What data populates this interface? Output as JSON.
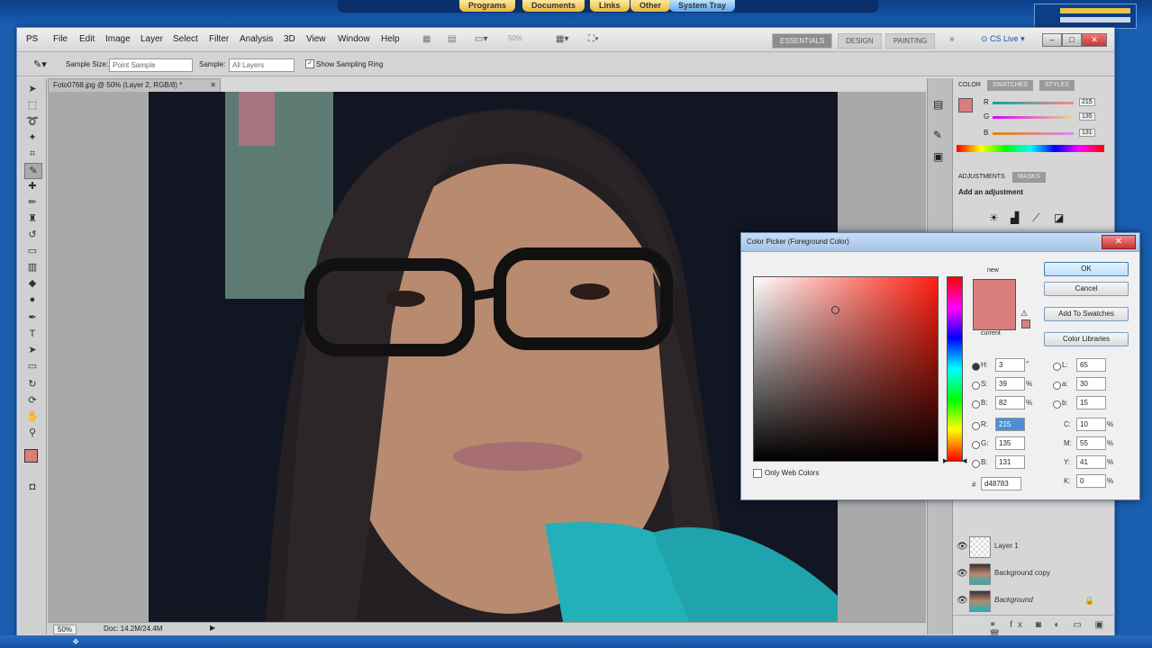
{
  "desktop": {
    "top_tabs": [
      "Programs",
      "Documents",
      "Links",
      "Other",
      "System Tray"
    ]
  },
  "photoshop": {
    "logo": "PS",
    "menu": [
      "File",
      "Edit",
      "Image",
      "Layer",
      "Select",
      "Filter",
      "Analysis",
      "3D",
      "View",
      "Window",
      "Help"
    ],
    "zoom_display": "50%",
    "workspaces": [
      "ESSENTIALS",
      "DESIGN",
      "PAINTING"
    ],
    "cs_live": "CS Live",
    "options_bar": {
      "sample_size_label": "Sample Size:",
      "sample_size_value": "Point Sample",
      "sample_label": "Sample:",
      "sample_value": "All Layers",
      "show_ring_label": "Show Sampling Ring"
    },
    "document_tab": "Foto0768.jpg @ 50% (Layer 2, RGB/8) *",
    "status": {
      "zoom": "50%",
      "doc": "Doc: 14.2M/24.4M"
    }
  },
  "panels": {
    "color_tabs": [
      "COLOR",
      "SWATCHES",
      "STYLES"
    ],
    "color_sliders": [
      {
        "channel": "R",
        "value": "215"
      },
      {
        "channel": "G",
        "value": "135"
      },
      {
        "channel": "B",
        "value": "131"
      }
    ],
    "adjustment_tabs": [
      "ADJUSTMENTS",
      "MASKS"
    ],
    "add_adjustment": "Add an adjustment",
    "layers": [
      {
        "name": "Layer 1"
      },
      {
        "name": "Background copy"
      },
      {
        "name": "Background"
      }
    ]
  },
  "color_picker": {
    "title": "Color Picker (Foreground Color)",
    "new_label": "new",
    "current_label": "current",
    "buttons": {
      "ok": "OK",
      "cancel": "Cancel",
      "add_swatches": "Add To Swatches",
      "libraries": "Color Libraries"
    },
    "only_web_colors": "Only Web Colors",
    "hsb": {
      "H": "3",
      "S": "39",
      "B": "82"
    },
    "rgb": {
      "R": "215",
      "G": "135",
      "B": "131"
    },
    "lab": {
      "L": "65",
      "a": "30",
      "b": "15"
    },
    "cmyk": {
      "C": "10",
      "M": "55",
      "Y": "41",
      "K": "0"
    },
    "hex": "d48783",
    "units": {
      "deg": "°",
      "pct": "%"
    },
    "colors": {
      "new": "#d87f7d",
      "current": "#d87f7d"
    }
  }
}
